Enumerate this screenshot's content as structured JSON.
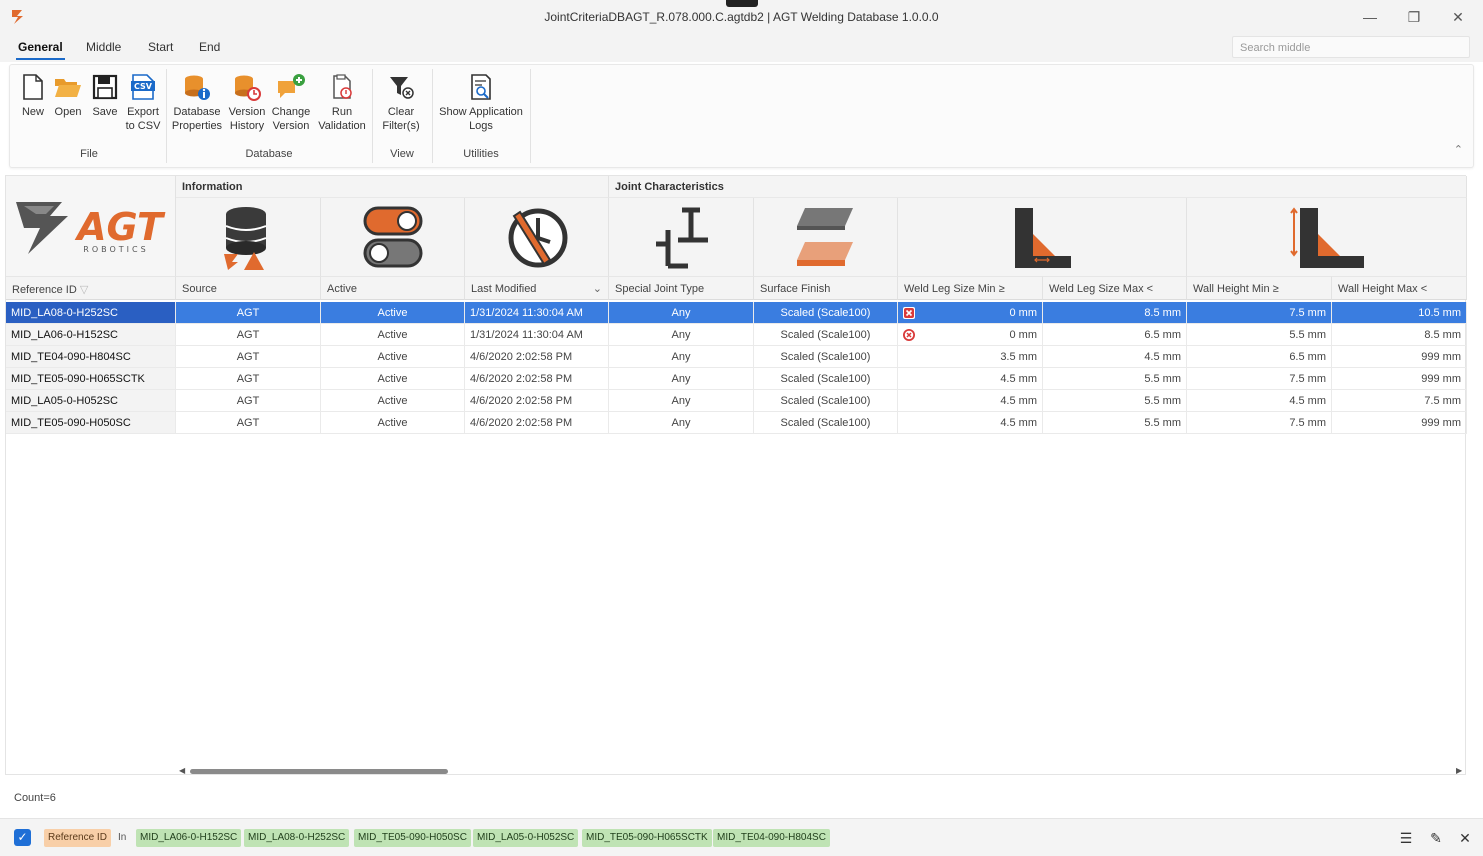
{
  "window": {
    "title": "JointCriteriaDBAGT_R.078.000.C.agtdb2 | AGT Welding Database 1.0.0.0",
    "minimize": "—",
    "maximize": "❐",
    "close": "✕"
  },
  "tabs": [
    "General",
    "Middle",
    "Start",
    "End"
  ],
  "search": {
    "placeholder": "Search middle"
  },
  "ribbon": {
    "file": {
      "group": "File",
      "new": "New",
      "open": "Open",
      "save": "Save",
      "export_1": "Export",
      "export_2": "to CSV",
      "csv_badge": "CSV"
    },
    "database": {
      "group": "Database",
      "props_1": "Database",
      "props_2": "Properties",
      "vh_1": "Version",
      "vh_2": "History",
      "cv_1": "Change",
      "cv_2": "Version",
      "rv_1": "Run",
      "rv_2": "Validation"
    },
    "view": {
      "group": "View",
      "clear_1": "Clear",
      "clear_2": "Filter(s)"
    },
    "utilities": {
      "group": "Utilities",
      "logs_1": "Show Application",
      "logs_2": "Logs"
    },
    "collapse": "⌃"
  },
  "logo": {
    "brand": "AGT",
    "sub": "ROBOTICS",
    "color": "#e06a2e"
  },
  "bands": {
    "information": "Information",
    "joint": "Joint Characteristics"
  },
  "columns": [
    "Reference ID",
    "Source",
    "Active",
    "Last Modified",
    "Special Joint Type",
    "Surface Finish",
    "Weld Leg Size Min ≥",
    "Weld Leg Size Max <",
    "Wall Height Min ≥",
    "Wall Height Max <"
  ],
  "rows": [
    {
      "ref": "MID_LA08-0-H252SC",
      "source": "AGT",
      "active": "Active",
      "modified": "1/31/2024 11:30:04 AM",
      "special": "Any",
      "surface": "Scaled (Scale100)",
      "wl_min": "0 mm",
      "wl_max": "8.5 mm",
      "wh_min": "7.5 mm",
      "wh_max": "10.5 mm",
      "error": true,
      "selected": true
    },
    {
      "ref": "MID_LA06-0-H152SC",
      "source": "AGT",
      "active": "Active",
      "modified": "1/31/2024 11:30:04 AM",
      "special": "Any",
      "surface": "Scaled (Scale100)",
      "wl_min": "0 mm",
      "wl_max": "6.5 mm",
      "wh_min": "5.5 mm",
      "wh_max": "8.5 mm",
      "error": true,
      "selected": false
    },
    {
      "ref": "MID_TE04-090-H804SC",
      "source": "AGT",
      "active": "Active",
      "modified": "4/6/2020 2:02:58 PM",
      "special": "Any",
      "surface": "Scaled (Scale100)",
      "wl_min": "3.5 mm",
      "wl_max": "4.5 mm",
      "wh_min": "6.5 mm",
      "wh_max": "999 mm",
      "error": false,
      "selected": false
    },
    {
      "ref": "MID_TE05-090-H065SCTK",
      "source": "AGT",
      "active": "Active",
      "modified": "4/6/2020 2:02:58 PM",
      "special": "Any",
      "surface": "Scaled (Scale100)",
      "wl_min": "4.5 mm",
      "wl_max": "5.5 mm",
      "wh_min": "7.5 mm",
      "wh_max": "999 mm",
      "error": false,
      "selected": false
    },
    {
      "ref": "MID_LA05-0-H052SC",
      "source": "AGT",
      "active": "Active",
      "modified": "4/6/2020 2:02:58 PM",
      "special": "Any",
      "surface": "Scaled (Scale100)",
      "wl_min": "4.5 mm",
      "wl_max": "5.5 mm",
      "wh_min": "4.5 mm",
      "wh_max": "7.5 mm",
      "error": false,
      "selected": false
    },
    {
      "ref": "MID_TE05-090-H050SC",
      "source": "AGT",
      "active": "Active",
      "modified": "4/6/2020 2:02:58 PM",
      "special": "Any",
      "surface": "Scaled (Scale100)",
      "wl_min": "4.5 mm",
      "wl_max": "5.5 mm",
      "wh_min": "7.5 mm",
      "wh_max": "999 mm",
      "error": false,
      "selected": false
    }
  ],
  "status": {
    "count": "Count=6"
  },
  "filter": {
    "enabled": true,
    "field": "Reference ID",
    "operator": "In",
    "values": [
      "MID_LA06-0-H152SC",
      "MID_LA08-0-H252SC",
      "MID_TE05-090-H050SC",
      "MID_LA05-0-H052SC",
      "MID_TE05-090-H065SCTK",
      "MID_TE04-090-H804SC"
    ],
    "icons": [
      "list-icon",
      "edit-icon",
      "close-icon"
    ]
  },
  "colors": {
    "accent": "#1b6ac9",
    "selection": "#3a7de0",
    "orange": "#e06a2e",
    "error": "#d93a3a"
  }
}
